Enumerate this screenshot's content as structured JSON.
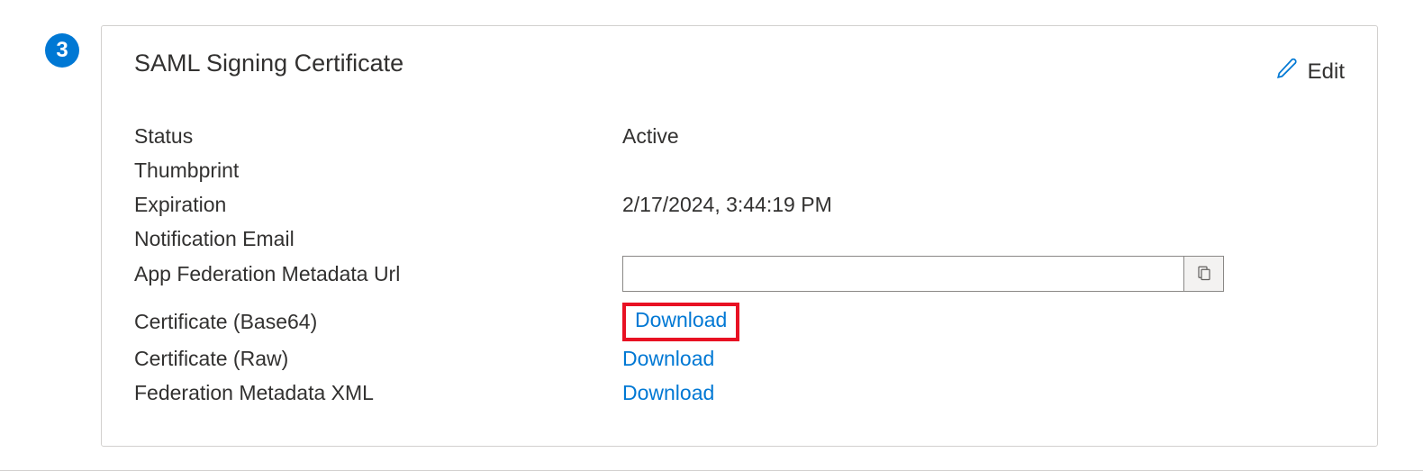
{
  "step_number": "3",
  "card": {
    "title": "SAML Signing Certificate",
    "edit_label": "Edit"
  },
  "fields": {
    "status": {
      "label": "Status",
      "value": "Active"
    },
    "thumbprint": {
      "label": "Thumbprint",
      "value": ""
    },
    "expiration": {
      "label": "Expiration",
      "value": "2/17/2024, 3:44:19 PM"
    },
    "notification_email": {
      "label": "Notification Email",
      "value": ""
    },
    "federation_url": {
      "label": "App Federation Metadata Url",
      "value": ""
    },
    "cert_base64": {
      "label": "Certificate (Base64)",
      "link": "Download"
    },
    "cert_raw": {
      "label": "Certificate (Raw)",
      "link": "Download"
    },
    "metadata_xml": {
      "label": "Federation Metadata XML",
      "link": "Download"
    }
  }
}
